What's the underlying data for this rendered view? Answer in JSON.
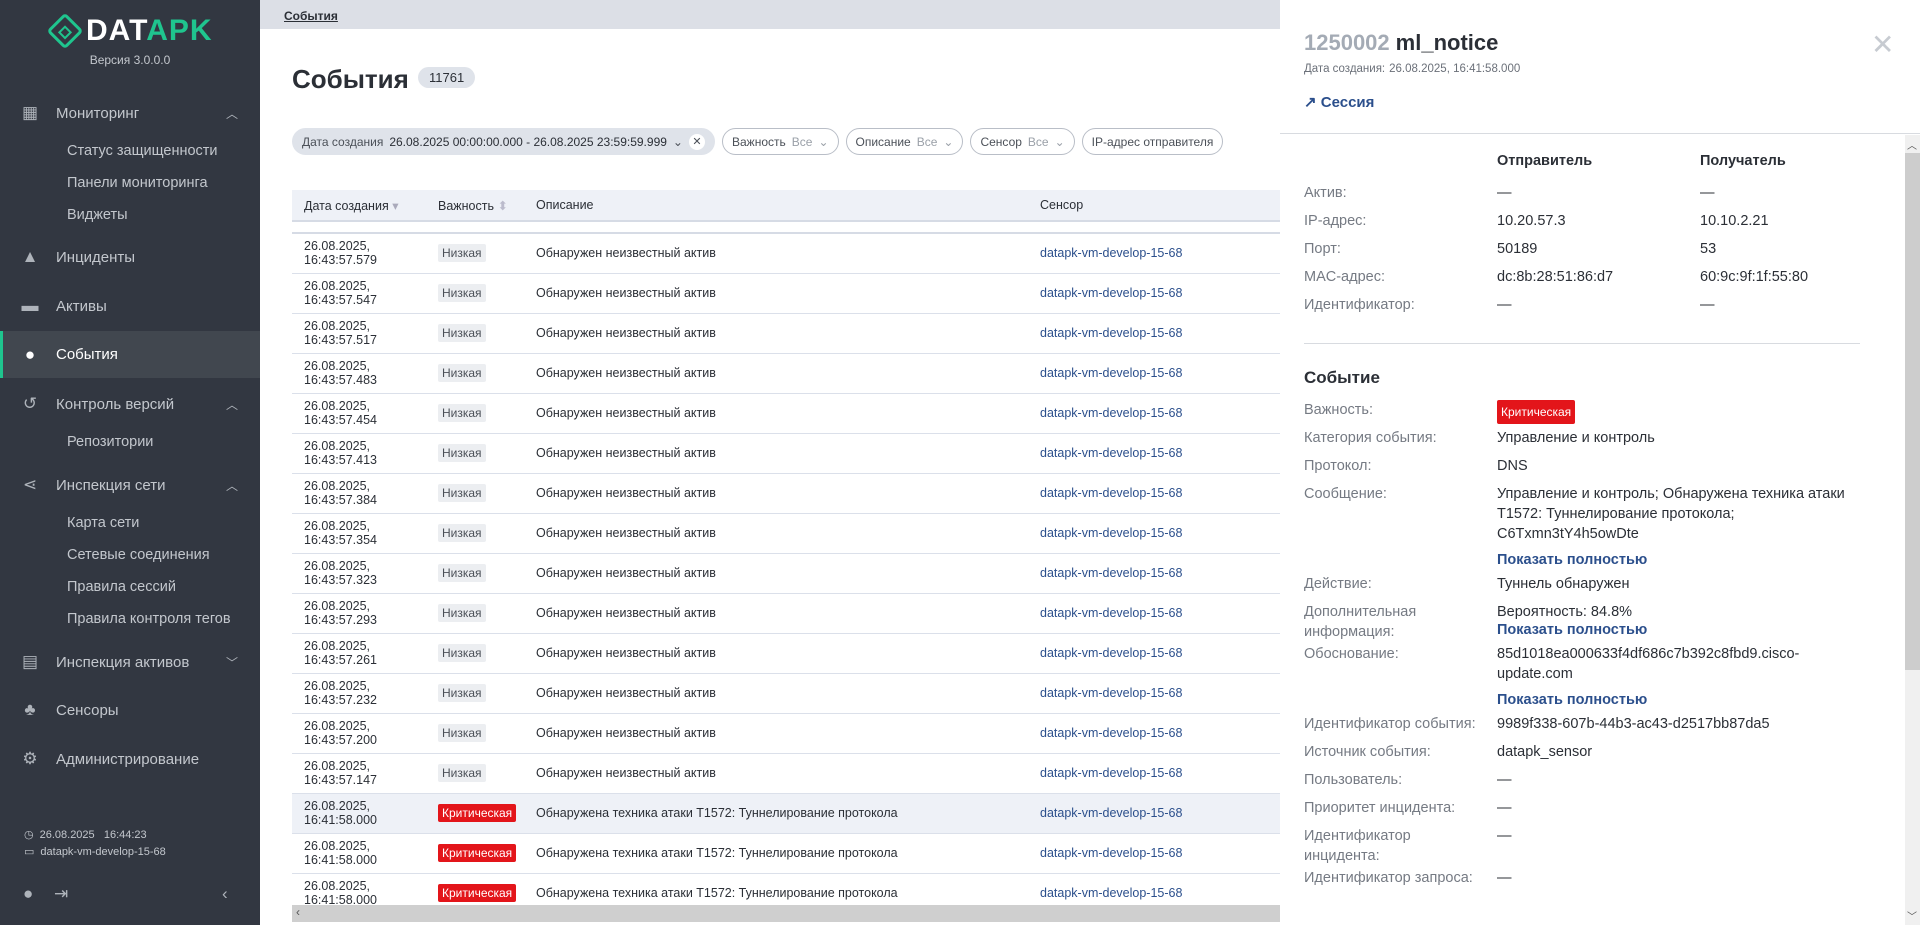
{
  "sidebar": {
    "logo": {
      "a": "DAT",
      "b": "APK"
    },
    "version": "Версия 3.0.0.0",
    "items": [
      {
        "label": "Мониторинг",
        "subs": [
          "Статус защищенности",
          "Панели мониторинга",
          "Виджеты"
        ]
      },
      {
        "label": "Инциденты"
      },
      {
        "label": "Активы"
      },
      {
        "label": "События"
      },
      {
        "label": "Контроль версий",
        "subs": [
          "Репозитории"
        ]
      },
      {
        "label": "Инспекция сети",
        "subs": [
          "Карта сети",
          "Сетевые соединения",
          "Правила сессий",
          "Правила контроля тегов"
        ]
      },
      {
        "label": "Инспекция активов"
      },
      {
        "label": "Сенсоры"
      },
      {
        "label": "Администрирование"
      }
    ],
    "clock": "26.08.2025   16:44:23",
    "host": "datapk-vm-develop-15-68"
  },
  "breadcrumb": "События",
  "page": {
    "title": "События",
    "count": "11761"
  },
  "filters": [
    {
      "label": "Дата создания",
      "value": "26.08.2025 00:00:00.000 - 26.08.2025 23:59:59.999"
    },
    {
      "label": "Важность",
      "value": "Все"
    },
    {
      "label": "Описание",
      "value": "Все"
    },
    {
      "label": "Сенсор",
      "value": "Все"
    },
    {
      "label": "IP-адрес отправителя"
    }
  ],
  "table": {
    "headers": [
      "Дата создания",
      "Важность",
      "Описание",
      "Сенсор"
    ],
    "rows": [
      [
        "26.08.2025, 16:43:57.579",
        "Низкая",
        "Обнаружен неизвестный актив",
        "datapk-vm-develop-15-68"
      ],
      [
        "26.08.2025, 16:43:57.547",
        "Низкая",
        "Обнаружен неизвестный актив",
        "datapk-vm-develop-15-68"
      ],
      [
        "26.08.2025, 16:43:57.517",
        "Низкая",
        "Обнаружен неизвестный актив",
        "datapk-vm-develop-15-68"
      ],
      [
        "26.08.2025, 16:43:57.483",
        "Низкая",
        "Обнаружен неизвестный актив",
        "datapk-vm-develop-15-68"
      ],
      [
        "26.08.2025, 16:43:57.454",
        "Низкая",
        "Обнаружен неизвестный актив",
        "datapk-vm-develop-15-68"
      ],
      [
        "26.08.2025, 16:43:57.413",
        "Низкая",
        "Обнаружен неизвестный актив",
        "datapk-vm-develop-15-68"
      ],
      [
        "26.08.2025, 16:43:57.384",
        "Низкая",
        "Обнаружен неизвестный актив",
        "datapk-vm-develop-15-68"
      ],
      [
        "26.08.2025, 16:43:57.354",
        "Низкая",
        "Обнаружен неизвестный актив",
        "datapk-vm-develop-15-68"
      ],
      [
        "26.08.2025, 16:43:57.323",
        "Низкая",
        "Обнаружен неизвестный актив",
        "datapk-vm-develop-15-68"
      ],
      [
        "26.08.2025, 16:43:57.293",
        "Низкая",
        "Обнаружен неизвестный актив",
        "datapk-vm-develop-15-68"
      ],
      [
        "26.08.2025, 16:43:57.261",
        "Низкая",
        "Обнаружен неизвестный актив",
        "datapk-vm-develop-15-68"
      ],
      [
        "26.08.2025, 16:43:57.232",
        "Низкая",
        "Обнаружен неизвестный актив",
        "datapk-vm-develop-15-68"
      ],
      [
        "26.08.2025, 16:43:57.200",
        "Низкая",
        "Обнаружен неизвестный актив",
        "datapk-vm-develop-15-68"
      ],
      [
        "26.08.2025, 16:43:57.147",
        "Низкая",
        "Обнаружен неизвестный актив",
        "datapk-vm-develop-15-68"
      ],
      [
        "26.08.2025, 16:41:58.000",
        "Критическая",
        "Обнаружена техника атаки T1572: Туннелирование протокола",
        "datapk-vm-develop-15-68"
      ],
      [
        "26.08.2025, 16:41:58.000",
        "Критическая",
        "Обнаружена техника атаки T1572: Туннелирование протокола",
        "datapk-vm-develop-15-68"
      ],
      [
        "26.08.2025, 16:41:58.000",
        "Критическая",
        "Обнаружена техника атаки T1572: Туннелирование протокола",
        "datapk-vm-develop-15-68"
      ]
    ]
  },
  "panel": {
    "id": "1250002",
    "name": "ml_notice",
    "date_label": "Дата создания:",
    "date": "26.08.2025, 16:41:58.000",
    "session": "Сессия",
    "net_headers": [
      "Отправитель",
      "Получатель"
    ],
    "net": [
      [
        "Актив:",
        "—",
        "—"
      ],
      [
        "IP-адрес:",
        "10.20.57.3",
        "10.10.2.21"
      ],
      [
        "Порт:",
        "50189",
        "53"
      ],
      [
        "MAC-адрес:",
        "dc:8b:28:51:86:d7",
        "60:9c:9f:1f:55:80"
      ],
      [
        "Идентификатор:",
        "—",
        "—"
      ]
    ],
    "event_title": "Событие",
    "show_more": "Показать полностью",
    "severity_label": "Важность:",
    "severity": "Критическая",
    "fields": [
      [
        "Категория события:",
        "Управление и контроль"
      ],
      [
        "Протокол:",
        "DNS"
      ],
      [
        "Сообщение:",
        "Управление и контроль; Обнаружена техника атаки T1572: Туннелирование протокола; C6Txmn3tY4h5owDte"
      ],
      [
        "Действие:",
        "Туннель обнаружен"
      ],
      [
        "Дополнительная информация:",
        "Вероятность: 84.8%"
      ],
      [
        "Обоснование:",
        "85d1018ea000633f4df686c7b392c8fbd9.cisco-update.com"
      ],
      [
        "Идентификатор события:",
        "9989f338-607b-44b3-ac43-d2517bb87da5"
      ],
      [
        "Источник события:",
        "datapk_sensor"
      ],
      [
        "Пользователь:",
        "—"
      ],
      [
        "Приоритет инцидента:",
        "—"
      ],
      [
        "Идентификатор инцидента:",
        "—"
      ],
      [
        "Идентификатор запроса:",
        "—"
      ]
    ]
  }
}
